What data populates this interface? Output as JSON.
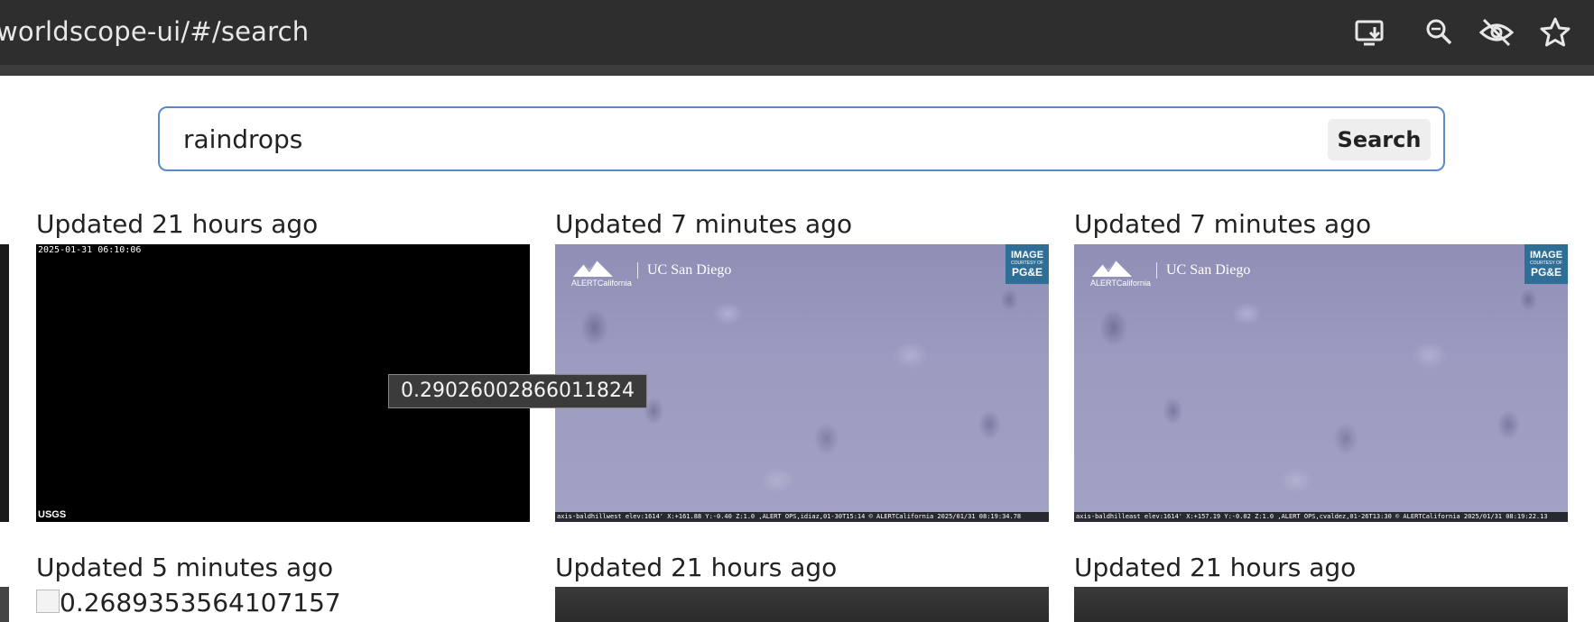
{
  "browser": {
    "url": "worldscope-ui/#/search",
    "icons": [
      "install-app-icon",
      "zoom-icon",
      "eye-slash-icon",
      "bookmark-star-icon"
    ]
  },
  "search": {
    "query": "raindrops",
    "button_label": "Search"
  },
  "results": [
    {
      "title": "Updated 21 hours ago",
      "image": "black-camera-frame",
      "timestamp": "2025-01-31 06:10:06",
      "watermark": "USGS"
    },
    {
      "title": "Updated 7 minutes ago",
      "image": "raindrops-on-lens",
      "footer": "axis-baldhillwest elev:1614' X:+161.88 Y:-0.40 Z:1.0 ,ALERT OPS,idiaz,01-30T15:14 © ALERTCalifornia 2025/01/31 08:19:34.78",
      "logo_text": "ALERTCalifornia",
      "partner": "UC San Diego",
      "badge": [
        "IMAGE",
        "COURTESY OF",
        "PG&E"
      ]
    },
    {
      "title": "Updated 7 minutes ago",
      "image": "raindrops-on-lens",
      "footer": "axis-baldhilleast elev:1614' X:+157.19 Y:-0.02 Z:1.0 ,ALERT OPS,cvaldez,01-26T13:30 © ALERTCalifornia 2025/01/31 08:19:22.13",
      "logo_text": "ALERTCalifornia",
      "partner": "UC San Diego",
      "badge": [
        "IMAGE",
        "COURTESY OF",
        "PG&E"
      ]
    },
    {
      "title": "Updated 5 minutes ago",
      "image_alt": "0.2689353564107157"
    },
    {
      "title": "Updated 21 hours ago",
      "image": "dark-camera-frame"
    },
    {
      "title": "Updated 21 hours ago",
      "image": "dark-camera-frame"
    }
  ],
  "tooltip": "0.29026002866011824"
}
